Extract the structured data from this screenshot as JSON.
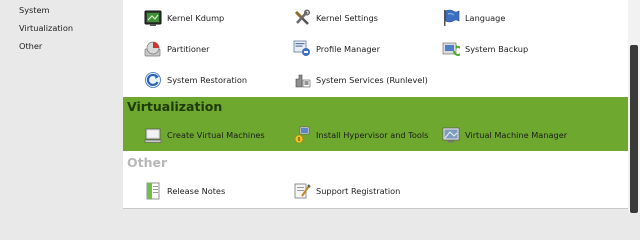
{
  "sidebar": {
    "items": [
      {
        "label": "System"
      },
      {
        "label": "Virtualization"
      },
      {
        "label": "Other"
      }
    ]
  },
  "system": {
    "items": [
      {
        "label": "Kernel Kdump",
        "icon": "kdump-icon"
      },
      {
        "label": "Kernel Settings",
        "icon": "tools-icon"
      },
      {
        "label": "Language",
        "icon": "language-flag-icon"
      },
      {
        "label": "Partitioner",
        "icon": "partitioner-icon"
      },
      {
        "label": "Profile Manager",
        "icon": "profile-manager-icon"
      },
      {
        "label": "System Backup",
        "icon": "system-backup-icon"
      },
      {
        "label": "System Restoration",
        "icon": "system-restoration-icon"
      },
      {
        "label": "System Services (Runlevel)",
        "icon": "system-services-icon"
      }
    ]
  },
  "virtualization": {
    "title": "Virtualization",
    "items": [
      {
        "label": "Create Virtual Machines",
        "icon": "create-vm-icon"
      },
      {
        "label": "Install Hypervisor and Tools",
        "icon": "install-hypervisor-icon"
      },
      {
        "label": "Virtual Machine Manager",
        "icon": "vm-manager-icon"
      }
    ]
  },
  "other": {
    "title": "Other",
    "items": [
      {
        "label": "Release Notes",
        "icon": "release-notes-icon"
      },
      {
        "label": "Support Registration",
        "icon": "support-registration-icon"
      }
    ]
  },
  "colors": {
    "virtualization_band": "#6ea82e",
    "virtualization_title": "#1e3b09",
    "other_title": "#b8b8b8",
    "scroll_thumb": "#3a3a3a"
  }
}
